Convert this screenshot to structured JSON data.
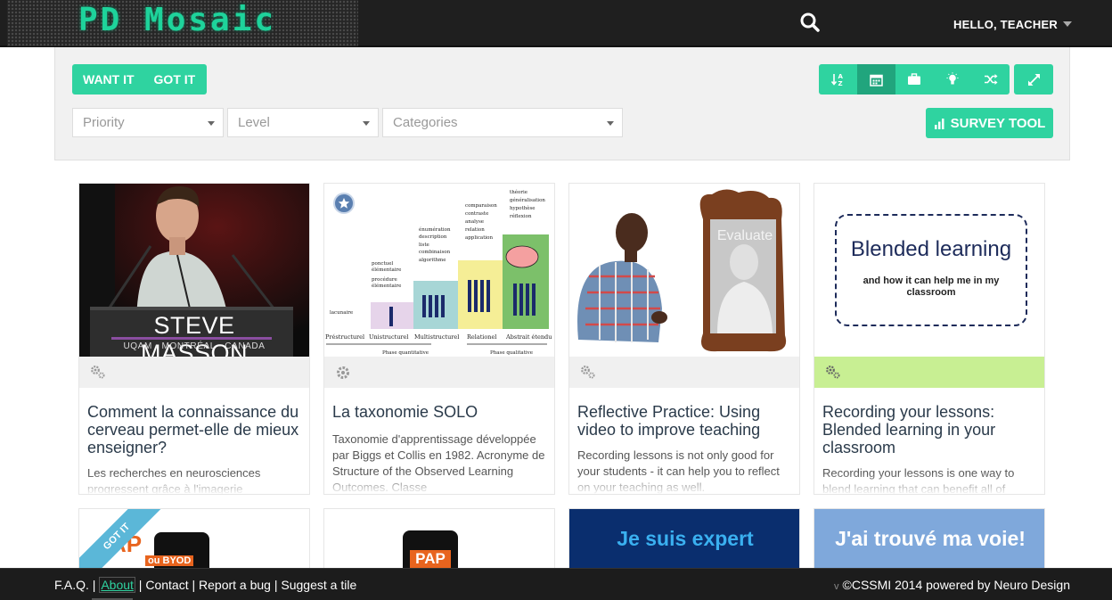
{
  "header": {
    "logo_text": "PD Mosaic",
    "greeting": "HELLO, TEACHER",
    "search_icon": "search-icon",
    "menu_icon": "caret-down-icon"
  },
  "filters": {
    "want_label": "WANT IT",
    "got_label": "GOT IT",
    "priority_placeholder": "Priority",
    "level_placeholder": "Level",
    "categories_placeholder": "Categories",
    "survey_label": "SURVEY TOOL",
    "view_buttons": [
      "sort-alpha-icon",
      "calendar-icon",
      "briefcase-icon",
      "lightbulb-icon",
      "shuffle-icon"
    ],
    "active_view": "calendar-icon",
    "expand_icon": "expand-icon"
  },
  "colors": {
    "accent": "#2fd3a0",
    "accent_dark": "#21a57d",
    "top_bar": "#1f1f1f",
    "tile_highlight": "#c8ef93"
  },
  "tiles": [
    {
      "image_caption": "STEVE MASSON",
      "image_subcaption": "UQAM - MONTRÉAL - CANADA",
      "title": "Comment la connaissance du cerveau permet-elle de mieux enseigner?",
      "description": "Les recherches en neurosciences progressent grâce à l'imagerie"
    },
    {
      "title": "La taxonomie SOLO",
      "description": "Taxonomie d'apprentissage développée par Biggs et Collis en 1982. Acronyme de Structure of the Observed Learning Outcomes. Classe",
      "diagram": {
        "stages": [
          "Préstructurel",
          "Unistructurel",
          "Multistructurel",
          "Relationel",
          "Abstrait étendu"
        ],
        "stage_terms": [
          [
            "lacunaire"
          ],
          [
            "ponctuel",
            "élémentaire",
            "procédure",
            "élémentaire"
          ],
          [
            "énumération",
            "description",
            "liste",
            "combinaison",
            "algorithme"
          ],
          [
            "comparaison",
            "contraste",
            "analyse",
            "relation",
            "application"
          ],
          [
            "théorie",
            "généralisation",
            "hypothèse",
            "réflexion"
          ]
        ],
        "phase_quant": "Phase quantitative",
        "phase_qual": "Phase qualitative"
      }
    },
    {
      "image_caption": "Evaluate",
      "title": "Reflective Practice: Using video to improve teaching",
      "description": "Recording lessons is not only good for your students - it can help you to reflect on your teaching as well."
    },
    {
      "image_caption": "Blended learning",
      "image_subcaption": "and how it can help me in my classroom",
      "title": "Recording your lessons: Blended learning in your classroom",
      "description": "Recording your lessons is one way to blend learning that can benefit all of"
    }
  ],
  "second_row": [
    {
      "ribbon": "GOT IT",
      "image_text": "AP",
      "image_subtext": "ou BYOD"
    },
    {
      "image_text": "PAP"
    },
    {
      "image_text": "Je suis expert"
    },
    {
      "image_text": "J'ai trouvé ma voie!"
    }
  ],
  "footer": {
    "links": [
      "F.A.Q.",
      "About",
      "Contact",
      "Report a bug",
      "Suggest a tile"
    ],
    "version_mark": "v",
    "copyright": "©CSSMI 2014 powered by Neuro Design"
  }
}
